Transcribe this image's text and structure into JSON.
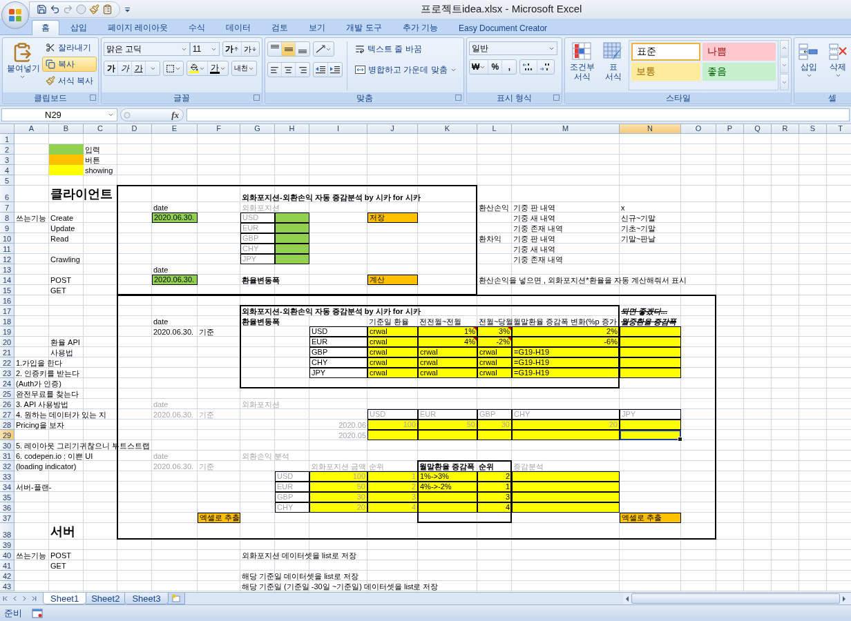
{
  "window": {
    "title": "프로젝트idea.xlsx - Microsoft Excel"
  },
  "tabs": [
    {
      "label": "홈",
      "selected": true
    },
    {
      "label": "삽입",
      "selected": false
    },
    {
      "label": "페이지 레이아웃",
      "selected": false
    },
    {
      "label": "수식",
      "selected": false
    },
    {
      "label": "데이터",
      "selected": false
    },
    {
      "label": "검토",
      "selected": false
    },
    {
      "label": "보기",
      "selected": false
    },
    {
      "label": "개발 도구",
      "selected": false
    },
    {
      "label": "추가 기능",
      "selected": false
    },
    {
      "label": "Easy Document Creator",
      "selected": false
    }
  ],
  "ribbon": {
    "clipboard": {
      "label": "클립보드",
      "paste": "붙여넣기",
      "items": [
        {
          "kind": "cut",
          "label": "잘라내기",
          "highlighted": false
        },
        {
          "kind": "copy",
          "label": "복사",
          "highlighted": true
        },
        {
          "kind": "format",
          "label": "서식 복사",
          "highlighted": false
        }
      ]
    },
    "font": {
      "label": "글꼴",
      "name": "맑은 고딕",
      "size": "11",
      "grow": "가",
      "shrink": "가",
      "styles": [
        {
          "kind": "bold",
          "label": "가"
        },
        {
          "kind": "italic",
          "label": "가"
        },
        {
          "kind": "underline",
          "label": "가"
        }
      ],
      "color_button": "가",
      "phonetic": "내천"
    },
    "alignment": {
      "label": "맞춤",
      "vertical": [
        {
          "selected": false
        },
        {
          "selected": true
        },
        {
          "selected": false
        }
      ],
      "horizontal": [
        {
          "selected": false
        },
        {
          "selected": false
        },
        {
          "selected": false
        }
      ],
      "wrap": "텍스트 줄 바꿈",
      "merge": "병합하고 가운데 맞춤"
    },
    "number": {
      "label": "표시 형식",
      "format": "일반",
      "buttons": [
        "₩",
        "%",
        ","
      ]
    },
    "styles": {
      "label": "스타일",
      "conditional": "조건부 서식",
      "table": "표 서식",
      "gallery": [
        {
          "label": "표준",
          "color": "#ffffff",
          "selected": true
        },
        {
          "label": "나쁨",
          "color": "#ffc7ce",
          "selected": false
        },
        {
          "label": "보통",
          "color": "#ffeb9c",
          "selected": false
        },
        {
          "label": "좋음",
          "color": "#c6efce",
          "selected": false
        }
      ]
    },
    "cells": {
      "label": "셀",
      "insert": "삽입",
      "delete": "삭제"
    }
  },
  "formula_bar": {
    "name_box": "N29",
    "fx": "fx"
  },
  "sheet": {
    "columns": [
      "A",
      "B",
      "C",
      "D",
      "E",
      "F",
      "G",
      "H",
      "I",
      "J",
      "K",
      "L",
      "M",
      "N",
      "O",
      "P",
      "Q",
      "R",
      "S",
      "T"
    ],
    "rows": [
      {
        "number": "1",
        "cells": []
      },
      {
        "number": "2",
        "cells": [
          "",
          {
            "kind": "text",
            "color": "#92d050",
            "bordered": false,
            "commented": false,
            "selected": false
          },
          {
            "text": "입력",
            "kind": "text",
            "bordered": false,
            "commented": false,
            "selected": false
          }
        ]
      },
      {
        "number": "3",
        "cells": [
          "",
          {
            "kind": "text",
            "color": "#ffc000",
            "bordered": false,
            "commented": false,
            "selected": false
          },
          {
            "text": "버튼",
            "kind": "text",
            "bordered": false,
            "commented": false,
            "selected": false
          }
        ]
      },
      {
        "number": "4",
        "cells": [
          "",
          {
            "kind": "text",
            "color": "#ffff00",
            "bordered": false,
            "commented": false,
            "selected": false
          },
          {
            "text": "showing",
            "kind": "text",
            "bordered": false,
            "commented": false,
            "selected": false
          }
        ]
      },
      {
        "number": "5",
        "cells": []
      },
      {
        "number": "6",
        "cells": [
          "",
          {
            "text": "클라이언트",
            "kind": "title",
            "bordered": false,
            "commented": false,
            "selected": false
          },
          "",
          "",
          "",
          "",
          {
            "text": "외화포지션-외환손익 자동 증감분석 by 시카 for 시카",
            "kind": "heading",
            "bordered": false,
            "commented": false,
            "selected": false
          }
        ]
      },
      {
        "number": "7",
        "cells": [
          "",
          "",
          "",
          "",
          {
            "text": "date",
            "kind": "text",
            "bordered": false,
            "commented": false,
            "selected": false
          },
          "",
          {
            "text": "외화포지션",
            "kind": "muted",
            "bordered": false,
            "commented": false,
            "selected": false
          },
          "",
          "",
          "",
          "",
          {
            "text": "환산손익",
            "kind": "text",
            "bordered": false,
            "commented": false,
            "selected": false
          },
          {
            "text": "기중 판 내역",
            "kind": "text",
            "bordered": false,
            "commented": false,
            "selected": false
          },
          {
            "text": "x",
            "kind": "text",
            "bordered": false,
            "commented": false,
            "selected": false
          }
        ]
      },
      {
        "number": "8",
        "cells": [
          {
            "text": "쓰는기능",
            "kind": "text",
            "bordered": false,
            "commented": false,
            "selected": false
          },
          {
            "text": "Create",
            "kind": "text",
            "bordered": false,
            "commented": false,
            "selected": false
          },
          "",
          "",
          {
            "text": "2020.06.30.",
            "kind": "text",
            "color": "#92d050",
            "bordered": true,
            "commented": false,
            "selected": false
          },
          "",
          {
            "text": "USD",
            "kind": "muted",
            "bordered": true,
            "commented": false,
            "selected": false
          },
          {
            "kind": "text",
            "color": "#92d050",
            "bordered": true,
            "commented": false,
            "selected": false
          },
          "",
          {
            "text": "저장",
            "kind": "text",
            "color": "#ffc000",
            "bordered": true,
            "commented": false,
            "selected": false
          },
          "",
          "",
          {
            "text": "기중 새 내역",
            "kind": "text",
            "bordered": false,
            "commented": false,
            "selected": false
          },
          {
            "text": "신규~기말",
            "kind": "text",
            "bordered": false,
            "commented": false,
            "selected": false
          }
        ]
      },
      {
        "number": "9",
        "cells": [
          "",
          {
            "text": "Update",
            "kind": "text",
            "bordered": false,
            "commented": false,
            "selected": false
          },
          "",
          "",
          "",
          "",
          {
            "text": "EUR",
            "kind": "muted",
            "bordered": true,
            "commented": false,
            "selected": false
          },
          {
            "kind": "text",
            "color": "#92d050",
            "bordered": true,
            "commented": false,
            "selected": false
          },
          "",
          "",
          "",
          "",
          {
            "text": "기중 존재 내역",
            "kind": "text",
            "bordered": false,
            "commented": false,
            "selected": false
          },
          {
            "text": "기초~기말",
            "kind": "text",
            "bordered": false,
            "commented": false,
            "selected": false
          }
        ]
      },
      {
        "number": "10",
        "cells": [
          "",
          {
            "text": "Read",
            "kind": "text",
            "bordered": false,
            "commented": false,
            "selected": false
          },
          "",
          "",
          "",
          "",
          {
            "text": "GBP",
            "kind": "muted",
            "bordered": true,
            "commented": false,
            "selected": false
          },
          {
            "kind": "text",
            "color": "#92d050",
            "bordered": true,
            "commented": false,
            "selected": false
          },
          "",
          "",
          "",
          {
            "text": "환차익",
            "kind": "text",
            "bordered": false,
            "commented": false,
            "selected": false
          },
          {
            "text": "기중 판 내역",
            "kind": "text",
            "bordered": false,
            "commented": false,
            "selected": false
          },
          {
            "text": "기말~판날",
            "kind": "text",
            "bordered": false,
            "commented": false,
            "selected": false
          }
        ]
      },
      {
        "number": "11",
        "cells": [
          "",
          "",
          "",
          "",
          "",
          "",
          {
            "text": "CHY",
            "kind": "muted",
            "bordered": true,
            "commented": false,
            "selected": false
          },
          {
            "kind": "text",
            "color": "#92d050",
            "bordered": true,
            "commented": false,
            "selected": false
          },
          "",
          "",
          "",
          "",
          {
            "text": "기중 새 내역",
            "kind": "text",
            "bordered": false,
            "commented": false,
            "selected": false
          }
        ]
      },
      {
        "number": "12",
        "cells": [
          "",
          {
            "text": "Crawling",
            "kind": "text",
            "bordered": false,
            "commented": false,
            "selected": false
          },
          "",
          "",
          "",
          "",
          {
            "text": "JPY",
            "kind": "muted",
            "bordered": true,
            "commented": false,
            "selected": false
          },
          {
            "kind": "text",
            "color": "#92d050",
            "bordered": true,
            "commented": false,
            "selected": false
          },
          "",
          "",
          "",
          "",
          {
            "text": "기중 존재 내역",
            "kind": "text",
            "bordered": false,
            "commented": false,
            "selected": false
          }
        ]
      },
      {
        "number": "13",
        "cells": [
          "",
          "",
          "",
          "",
          {
            "text": "date",
            "kind": "text",
            "bordered": false,
            "commented": false,
            "selected": false
          }
        ]
      },
      {
        "number": "14",
        "cells": [
          "",
          {
            "text": "POST",
            "kind": "text",
            "bordered": false,
            "commented": false,
            "selected": false
          },
          "",
          "",
          {
            "text": "2020.06.30.",
            "kind": "text",
            "color": "#92d050",
            "bordered": true,
            "commented": false,
            "selected": false
          },
          "",
          {
            "text": "환율변동폭",
            "kind": "heading",
            "bordered": false,
            "commented": false,
            "selected": false
          },
          "",
          "",
          {
            "text": "계산",
            "kind": "text",
            "color": "#ffc000",
            "bordered": true,
            "commented": false,
            "selected": false
          },
          "",
          {
            "text": "환산손익을 넣으면 , 외화포지션*환율을 자동 계산해줘서 표시",
            "kind": "text",
            "bordered": false,
            "commented": false,
            "selected": false
          }
        ]
      },
      {
        "number": "15",
        "cells": [
          "",
          {
            "text": "GET",
            "kind": "text",
            "bordered": false,
            "commented": false,
            "selected": false
          }
        ]
      },
      {
        "number": "16",
        "cells": []
      },
      {
        "number": "17",
        "cells": [
          "",
          "",
          "",
          "",
          "",
          "",
          {
            "text": "외화포지션-외환손익 자동 증감분석 by 시카 for 시카",
            "kind": "heading",
            "bordered": false,
            "commented": false,
            "selected": false
          },
          "",
          "",
          "",
          "",
          "",
          "",
          {
            "text": "되면 좋겠다...",
            "kind": "struck",
            "bordered": false,
            "commented": false,
            "selected": false
          }
        ]
      },
      {
        "number": "18",
        "cells": [
          "",
          "",
          "",
          "",
          {
            "text": "date",
            "kind": "text",
            "bordered": false,
            "commented": false,
            "selected": false
          },
          "",
          {
            "text": "환율변동폭",
            "kind": "heading",
            "bordered": false,
            "commented": false,
            "selected": false
          },
          "",
          "",
          {
            "text": "기준일 환율",
            "kind": "text",
            "bordered": false,
            "commented": false,
            "selected": false
          },
          {
            "text": "전전월~전월",
            "kind": "text",
            "bordered": false,
            "commented": false,
            "selected": false
          },
          {
            "text": "전월~당월",
            "kind": "text",
            "bordered": false,
            "commented": false,
            "selected": false
          },
          {
            "text": "월말환율 증감폭 변화(%p 증가",
            "kind": "text",
            "bordered": false,
            "commented": false,
            "selected": false
          },
          {
            "text": "월중환율 증감폭",
            "kind": "struck",
            "bordered": false,
            "commented": false,
            "selected": false
          }
        ]
      },
      {
        "number": "19",
        "cells": [
          "",
          "",
          "",
          "",
          {
            "text": "2020.06.30.",
            "kind": "text",
            "bordered": false,
            "commented": false,
            "selected": false
          },
          {
            "text": "기준",
            "kind": "text",
            "bordered": false,
            "commented": false,
            "selected": false
          },
          "",
          "",
          {
            "text": "USD",
            "kind": "text",
            "bordered": true,
            "commented": false,
            "selected": false
          },
          {
            "text": "crwal",
            "kind": "text",
            "color": "#ffff00",
            "bordered": true,
            "commented": false,
            "selected": false
          },
          {
            "text": "1%",
            "kind": "number",
            "color": "#ffff00",
            "bordered": true,
            "commented": true,
            "selected": false
          },
          {
            "text": "3%",
            "kind": "number",
            "color": "#ffff00",
            "bordered": true,
            "commented": true,
            "selected": false
          },
          {
            "text": "2%",
            "kind": "number",
            "color": "#ffff00",
            "bordered": true,
            "commented": false,
            "selected": false
          },
          {
            "kind": "text",
            "color": "#ffff00",
            "bordered": true,
            "commented": false,
            "selected": false
          }
        ]
      },
      {
        "number": "20",
        "cells": [
          "",
          {
            "text": "환율 API",
            "kind": "text",
            "bordered": false,
            "commented": false,
            "selected": false
          },
          "",
          "",
          "",
          "",
          "",
          "",
          {
            "text": "EUR",
            "kind": "text",
            "bordered": true,
            "commented": false,
            "selected": false
          },
          {
            "text": "crwal",
            "kind": "text",
            "color": "#ffff00",
            "bordered": true,
            "commented": false,
            "selected": false
          },
          {
            "text": "4%",
            "kind": "number",
            "color": "#ffff00",
            "bordered": true,
            "commented": true,
            "selected": false
          },
          {
            "text": "-2%",
            "kind": "number",
            "color": "#ffff00",
            "bordered": true,
            "commented": true,
            "selected": false
          },
          {
            "text": "-6%",
            "kind": "number",
            "color": "#ffff00",
            "bordered": true,
            "commented": false,
            "selected": false
          },
          {
            "kind": "text",
            "color": "#ffff00",
            "bordered": true,
            "commented": false,
            "selected": false
          }
        ]
      },
      {
        "number": "21",
        "cells": [
          "",
          {
            "text": "사용법",
            "kind": "text",
            "bordered": false,
            "commented": false,
            "selected": false
          },
          "",
          "",
          "",
          "",
          "",
          "",
          {
            "text": "GBP",
            "kind": "text",
            "bordered": true,
            "commented": false,
            "selected": false
          },
          {
            "text": "crwal",
            "kind": "text",
            "color": "#ffff00",
            "bordered": true,
            "commented": false,
            "selected": false
          },
          {
            "text": "crwal",
            "kind": "text",
            "color": "#ffff00",
            "bordered": true,
            "commented": false,
            "selected": false
          },
          {
            "text": "crwal",
            "kind": "text",
            "color": "#ffff00",
            "bordered": true,
            "commented": false,
            "selected": false
          },
          {
            "text": "=G19-H19",
            "kind": "text",
            "color": "#ffff00",
            "bordered": true,
            "commented": false,
            "selected": false
          },
          {
            "kind": "text",
            "color": "#ffff00",
            "bordered": true,
            "commented": false,
            "selected": false
          }
        ]
      },
      {
        "number": "22",
        "cells": [
          {
            "text": "1.가입을 한다",
            "kind": "text",
            "bordered": false,
            "commented": false,
            "selected": false
          },
          "",
          "",
          "",
          "",
          "",
          "",
          "",
          {
            "text": "CHY",
            "kind": "text",
            "bordered": true,
            "commented": false,
            "selected": false
          },
          {
            "text": "crwal",
            "kind": "text",
            "color": "#ffff00",
            "bordered": true,
            "commented": false,
            "selected": false
          },
          {
            "text": "crwal",
            "kind": "text",
            "color": "#ffff00",
            "bordered": true,
            "commented": false,
            "selected": false
          },
          {
            "text": "crwal",
            "kind": "text",
            "color": "#ffff00",
            "bordered": true,
            "commented": false,
            "selected": false
          },
          {
            "text": "=G19-H19",
            "kind": "text",
            "color": "#ffff00",
            "bordered": true,
            "commented": false,
            "selected": false
          },
          {
            "kind": "text",
            "color": "#ffff00",
            "bordered": true,
            "commented": false,
            "selected": false
          }
        ]
      },
      {
        "number": "23",
        "cells": [
          {
            "text": "2. 인증키를 받는다",
            "kind": "text",
            "bordered": false,
            "commented": false,
            "selected": false
          },
          "",
          "",
          "",
          "",
          "",
          "",
          "",
          {
            "text": "JPY",
            "kind": "text",
            "bordered": true,
            "commented": false,
            "selected": false
          },
          {
            "text": "crwal",
            "kind": "text",
            "color": "#ffff00",
            "bordered": true,
            "commented": false,
            "selected": false
          },
          {
            "text": "crwal",
            "kind": "text",
            "color": "#ffff00",
            "bordered": true,
            "commented": false,
            "selected": false
          },
          {
            "text": "crwal",
            "kind": "text",
            "color": "#ffff00",
            "bordered": true,
            "commented": false,
            "selected": false
          },
          {
            "text": "=G19-H19",
            "kind": "text",
            "color": "#ffff00",
            "bordered": true,
            "commented": false,
            "selected": false
          },
          {
            "kind": "text",
            "color": "#ffff00",
            "bordered": true,
            "commented": false,
            "selected": false
          }
        ]
      },
      {
        "number": "24",
        "cells": [
          {
            "text": "(Auth가 인증)",
            "kind": "text",
            "bordered": false,
            "commented": false,
            "selected": false
          }
        ]
      },
      {
        "number": "25",
        "cells": [
          {
            "text": "완전무료를 찾는다",
            "kind": "text",
            "bordered": false,
            "commented": false,
            "selected": false
          }
        ]
      },
      {
        "number": "26",
        "cells": [
          {
            "text": "3. API 사용방법",
            "kind": "text",
            "bordered": false,
            "commented": false,
            "selected": false
          },
          "",
          "",
          "",
          {
            "text": "date",
            "kind": "muted",
            "bordered": false,
            "commented": false,
            "selected": false
          },
          "",
          {
            "text": "외화포지션",
            "kind": "muted",
            "bordered": false,
            "commented": false,
            "selected": false
          }
        ]
      },
      {
        "number": "27",
        "cells": [
          {
            "text": "4. 원하는 데이터가 있는 지",
            "kind": "text",
            "bordered": false,
            "commented": false,
            "selected": false
          },
          "",
          "",
          "",
          {
            "text": "2020.06.30.",
            "kind": "muted",
            "bordered": false,
            "commented": false,
            "selected": false
          },
          {
            "text": "기준",
            "kind": "muted",
            "bordered": false,
            "commented": false,
            "selected": false
          },
          "",
          "",
          "",
          {
            "text": "USD",
            "kind": "muted",
            "bordered": true,
            "commented": false,
            "selected": false
          },
          {
            "text": "EUR",
            "kind": "muted",
            "bordered": true,
            "commented": false,
            "selected": false
          },
          {
            "text": "GBP",
            "kind": "muted",
            "bordered": true,
            "commented": false,
            "selected": false
          },
          {
            "text": "CHY",
            "kind": "muted",
            "bordered": true,
            "commented": false,
            "selected": false
          },
          {
            "text": "JPY",
            "kind": "muted",
            "bordered": true,
            "commented": false,
            "selected": false
          }
        ]
      },
      {
        "number": "28",
        "cells": [
          {
            "text": "Pricing을 보자",
            "kind": "text",
            "bordered": false,
            "commented": false,
            "selected": false
          },
          "",
          "",
          "",
          "",
          "",
          "",
          "",
          {
            "text": "2020.06",
            "kind": "dimnumber",
            "bordered": false,
            "commented": false,
            "selected": false
          },
          {
            "text": "100",
            "kind": "dimnumber",
            "color": "#ffff00",
            "bordered": true,
            "commented": false,
            "selected": false
          },
          {
            "text": "50",
            "kind": "dimnumber",
            "color": "#ffff00",
            "bordered": true,
            "commented": false,
            "selected": false
          },
          {
            "text": "30",
            "kind": "dimnumber",
            "color": "#ffff00",
            "bordered": true,
            "commented": false,
            "selected": false
          },
          {
            "text": "20",
            "kind": "dimnumber",
            "color": "#ffff00",
            "bordered": true,
            "commented": false,
            "selected": false
          },
          {
            "kind": "text",
            "color": "#ffff00",
            "bordered": true,
            "commented": false,
            "selected": false
          }
        ]
      },
      {
        "number": "29",
        "cells": [
          "",
          "",
          "",
          "",
          "",
          "",
          "",
          "",
          {
            "text": "2020.05",
            "kind": "dimnumber",
            "bordered": false,
            "commented": false,
            "selected": false
          },
          {
            "kind": "text",
            "color": "#ffff00",
            "bordered": true,
            "commented": false,
            "selected": false
          },
          {
            "kind": "text",
            "color": "#ffff00",
            "bordered": true,
            "commented": false,
            "selected": false
          },
          {
            "kind": "text",
            "color": "#ffff00",
            "bordered": true,
            "commented": false,
            "selected": false
          },
          {
            "kind": "text",
            "color": "#ffff00",
            "bordered": true,
            "commented": false,
            "selected": false
          },
          {
            "kind": "text",
            "color": "#ffff00",
            "bordered": true,
            "commented": false,
            "selected": true
          }
        ]
      },
      {
        "number": "30",
        "cells": [
          {
            "text": "5. 레이아웃 그리기귀찮으니 부트스트랩",
            "kind": "text",
            "bordered": false,
            "commented": false,
            "selected": false
          }
        ]
      },
      {
        "number": "31",
        "cells": [
          {
            "text": "6. codepen.io : 이쁜 UI",
            "kind": "text",
            "bordered": false,
            "commented": false,
            "selected": false
          },
          "",
          "",
          "",
          {
            "text": "date",
            "kind": "muted",
            "bordered": false,
            "commented": false,
            "selected": false
          },
          "",
          {
            "text": "외환손익 분석",
            "kind": "muted",
            "bordered": false,
            "commented": false,
            "selected": false
          }
        ]
      },
      {
        "number": "32",
        "cells": [
          {
            "text": "(loading indicator)",
            "kind": "text",
            "bordered": false,
            "commented": false,
            "selected": false
          },
          "",
          "",
          "",
          {
            "text": "2020.06.30.",
            "kind": "muted",
            "bordered": false,
            "commented": false,
            "selected": false
          },
          {
            "text": "기준",
            "kind": "muted",
            "bordered": false,
            "commented": false,
            "selected": false
          },
          "",
          "",
          {
            "text": "외화포지션 금액",
            "kind": "muted",
            "bordered": false,
            "commented": false,
            "selected": false
          },
          {
            "text": "순위",
            "kind": "muted",
            "bordered": false,
            "commented": false,
            "selected": false
          },
          {
            "text": "월말환율 증감폭",
            "kind": "heading",
            "bordered": false,
            "commented": false,
            "selected": false
          },
          {
            "text": "순위",
            "kind": "heading",
            "bordered": false,
            "commented": false,
            "selected": false
          },
          {
            "text": "증감분석",
            "kind": "muted",
            "bordered": false,
            "commented": false,
            "selected": false
          }
        ]
      },
      {
        "number": "33",
        "cells": [
          "",
          "",
          "",
          "",
          "",
          "",
          "",
          {
            "text": "USD",
            "kind": "muted",
            "bordered": true,
            "commented": false,
            "selected": false
          },
          {
            "text": "100",
            "kind": "dimnumber",
            "color": "#ffff00",
            "bordered": true,
            "commented": false,
            "selected": false
          },
          {
            "text": "1",
            "kind": "dimnumber",
            "color": "#ffff00",
            "bordered": true,
            "commented": false,
            "selected": false
          },
          {
            "text": "1%->3%",
            "kind": "text",
            "color": "#ffff00",
            "bordered": true,
            "commented": false,
            "selected": false
          },
          {
            "text": "2",
            "kind": "number",
            "color": "#ffff00",
            "bordered": true,
            "commented": false,
            "selected": false
          },
          {
            "kind": "text",
            "color": "#ffff00",
            "bordered": true,
            "commented": false,
            "selected": false
          }
        ]
      },
      {
        "number": "34",
        "cells": [
          {
            "text": "서버-플랜-",
            "kind": "text",
            "bordered": false,
            "commented": false,
            "selected": false
          },
          "",
          "",
          "",
          "",
          "",
          "",
          {
            "text": "EUR",
            "kind": "muted",
            "bordered": true,
            "commented": false,
            "selected": false
          },
          {
            "text": "50",
            "kind": "dimnumber",
            "color": "#ffff00",
            "bordered": true,
            "commented": false,
            "selected": false
          },
          {
            "text": "2",
            "kind": "dimnumber",
            "color": "#ffff00",
            "bordered": true,
            "commented": false,
            "selected": false
          },
          {
            "text": "4%->-2%",
            "kind": "text",
            "color": "#ffff00",
            "bordered": true,
            "commented": false,
            "selected": false
          },
          {
            "text": "1",
            "kind": "number",
            "color": "#ffff00",
            "bordered": true,
            "commented": false,
            "selected": false
          },
          {
            "kind": "text",
            "color": "#ffff00",
            "bordered": true,
            "commented": false,
            "selected": false
          }
        ]
      },
      {
        "number": "35",
        "cells": [
          "",
          "",
          "",
          "",
          "",
          "",
          "",
          {
            "text": "GBP",
            "kind": "muted",
            "bordered": true,
            "commented": false,
            "selected": false
          },
          {
            "text": "30",
            "kind": "dimnumber",
            "color": "#ffff00",
            "bordered": true,
            "commented": false,
            "selected": false
          },
          {
            "text": "3",
            "kind": "dimnumber",
            "color": "#ffff00",
            "bordered": true,
            "commented": false,
            "selected": false
          },
          {
            "kind": "text",
            "color": "#ffff00",
            "bordered": true,
            "commented": false,
            "selected": false
          },
          {
            "text": "3",
            "kind": "number",
            "color": "#ffff00",
            "bordered": true,
            "commented": false,
            "selected": false
          },
          {
            "kind": "text",
            "color": "#ffff00",
            "bordered": true,
            "commented": false,
            "selected": false
          }
        ]
      },
      {
        "number": "36",
        "cells": [
          "",
          "",
          "",
          "",
          "",
          "",
          "",
          {
            "text": "CHY",
            "kind": "muted",
            "bordered": true,
            "commented": false,
            "selected": false
          },
          {
            "text": "20",
            "kind": "dimnumber",
            "color": "#ffff00",
            "bordered": true,
            "commented": false,
            "selected": false
          },
          {
            "text": "4",
            "kind": "dimnumber",
            "color": "#ffff00",
            "bordered": true,
            "commented": false,
            "selected": false
          },
          {
            "kind": "text",
            "color": "#ffff00",
            "bordered": true,
            "commented": false,
            "selected": false
          },
          {
            "text": "4",
            "kind": "number",
            "color": "#ffff00",
            "bordered": true,
            "commented": false,
            "selected": false
          },
          {
            "kind": "text",
            "color": "#ffff00",
            "bordered": true,
            "commented": false,
            "selected": false
          }
        ]
      },
      {
        "number": "37",
        "cells": [
          "",
          "",
          "",
          "",
          "",
          {
            "text": "엑셀로 추출",
            "kind": "text",
            "color": "#ffc000",
            "bordered": true,
            "commented": false,
            "selected": false
          },
          "",
          "",
          "",
          "",
          "",
          "",
          "",
          {
            "text": "엑셀로 추출",
            "kind": "text",
            "color": "#ffc000",
            "bordered": true,
            "commented": false,
            "selected": false
          }
        ]
      },
      {
        "number": "38",
        "cells": [
          "",
          {
            "text": "서버",
            "kind": "title",
            "bordered": false,
            "commented": false,
            "selected": false
          }
        ]
      },
      {
        "number": "39",
        "cells": []
      },
      {
        "number": "40",
        "cells": [
          {
            "text": "쓰는기능",
            "kind": "text",
            "bordered": false,
            "commented": false,
            "selected": false
          },
          {
            "text": "POST",
            "kind": "text",
            "bordered": false,
            "commented": false,
            "selected": false
          },
          "",
          "",
          "",
          "",
          {
            "text": "외화포지션 데이터셋을 list로 저장",
            "kind": "text",
            "bordered": false,
            "commented": false,
            "selected": false
          }
        ]
      },
      {
        "number": "41",
        "cells": [
          "",
          {
            "text": "GET",
            "kind": "text",
            "bordered": false,
            "commented": false,
            "selected": false
          }
        ]
      },
      {
        "number": "42",
        "cells": [
          "",
          "",
          "",
          "",
          "",
          "",
          {
            "text": "해당 기준일 데이터셋을 list로 저장",
            "kind": "text",
            "bordered": false,
            "commented": false,
            "selected": false
          }
        ]
      },
      {
        "number": "43",
        "cells": [
          "",
          "",
          "",
          "",
          "",
          "",
          {
            "text": "해당 기준일 (기준일 -30일 ~기준일) 데이터셋을 list로 저장",
            "kind": "text",
            "bordered": false,
            "commented": false,
            "selected": false
          }
        ]
      }
    ]
  },
  "sheet_tabs": [
    {
      "label": "Sheet1",
      "selected": true
    },
    {
      "label": "Sheet2",
      "selected": false
    },
    {
      "label": "Sheet3",
      "selected": false
    }
  ],
  "status_bar": {
    "mode": "준비"
  }
}
